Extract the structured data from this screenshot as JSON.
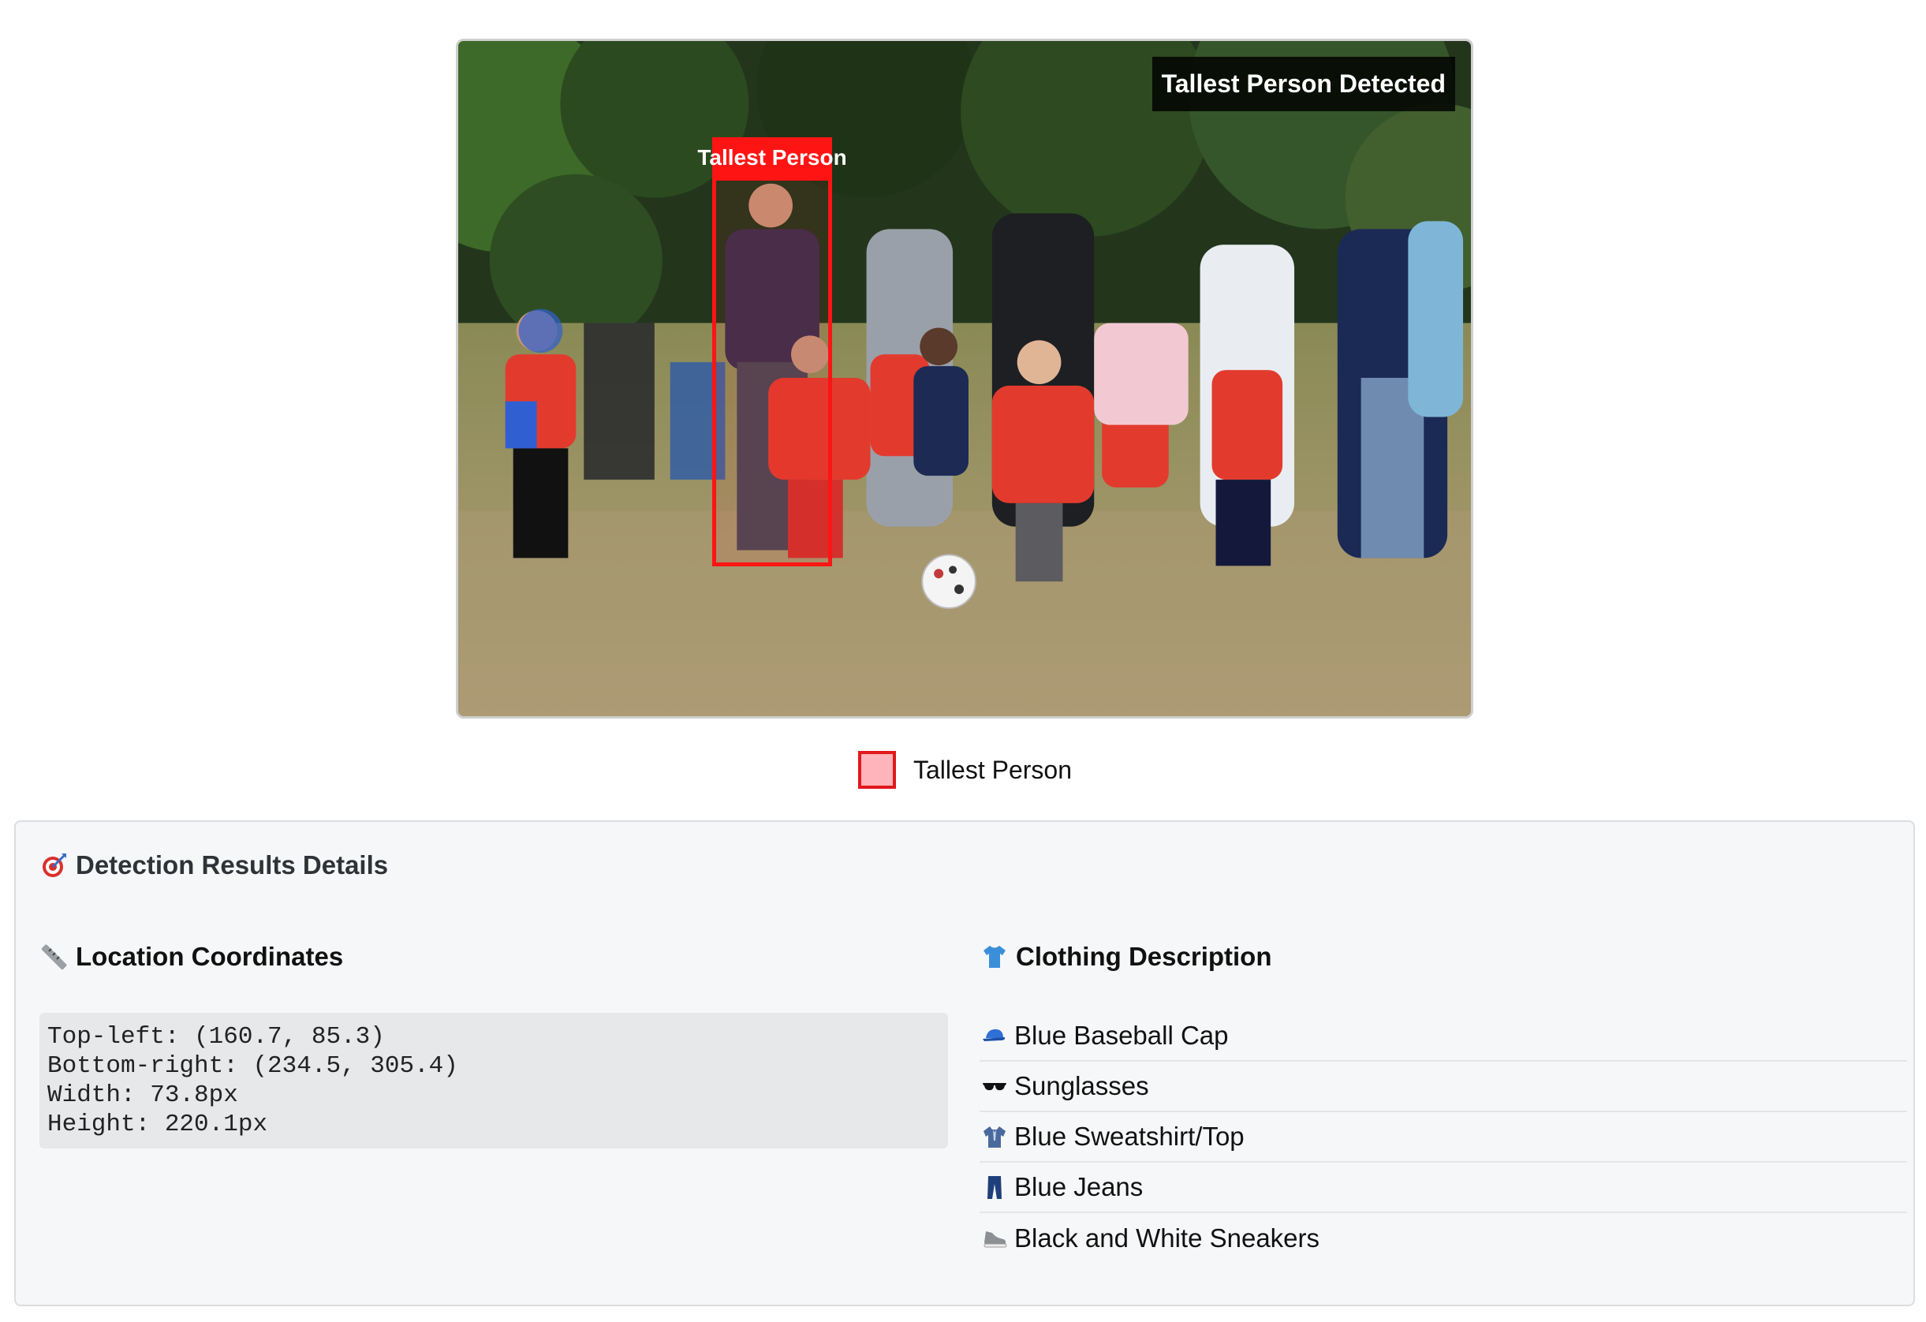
{
  "image_panel": {
    "banner": "Tallest Person Detected",
    "box_label": "Tallest Person"
  },
  "legend": {
    "label": "Tallest Person",
    "swatch_color": "#ffb3ba",
    "border_color": "#e0191c"
  },
  "details": {
    "title": "Detection Results Details",
    "title_icon": "target-icon",
    "location": {
      "heading": "Location Coordinates",
      "icon": "ruler-icon",
      "lines": [
        "Top-left: (160.7, 85.3)",
        "Bottom-right: (234.5, 305.4)",
        "Width: 73.8px",
        "Height: 220.1px"
      ]
    },
    "clothing": {
      "heading": "Clothing Description",
      "icon": "shirt-icon",
      "items": [
        {
          "icon": "cap-icon",
          "label": "Blue Baseball Cap"
        },
        {
          "icon": "sunglasses-icon",
          "label": "Sunglasses"
        },
        {
          "icon": "sweatshirt-icon",
          "label": "Blue Sweatshirt/Top"
        },
        {
          "icon": "jeans-icon",
          "label": "Blue Jeans"
        },
        {
          "icon": "sneaker-icon",
          "label": "Black and White Sneakers"
        }
      ]
    }
  }
}
